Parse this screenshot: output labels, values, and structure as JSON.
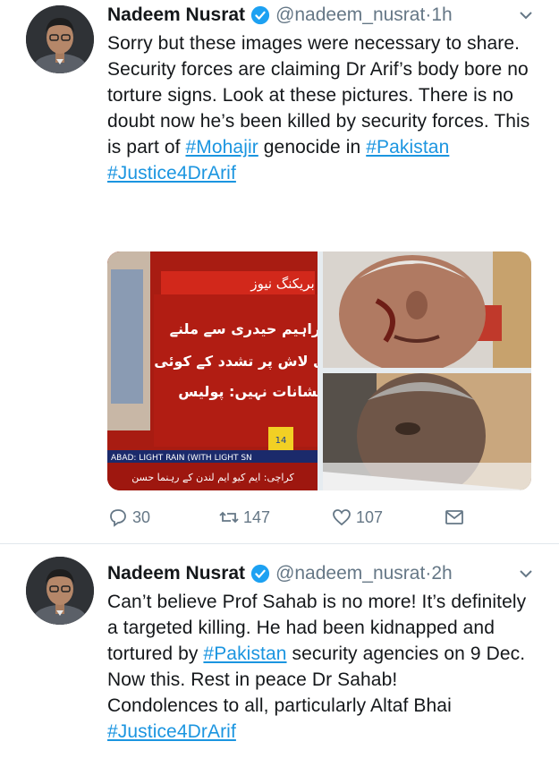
{
  "tweets": [
    {
      "author_name": "Nadeem Nusrat",
      "handle": "@nadeem_nusrat",
      "time": "1h",
      "body_lines": [
        "Sorry but these images were necessary to share.",
        "Security forces are claiming Dr Arif’s body bore no torture signs. Look at these pictures. There is no doubt now he’s been killed by security forces. This is part of"
      ],
      "hashtag_mohajir": "#Mohajir",
      "genocide_in": " genocide in ",
      "hashtag_pakistan": "#Pakistan",
      "hashtag_justice": "#Justice4DrArif",
      "media": {
        "news_header": "بریکنگ نیوز",
        "news_text_1": "ابراہیم حیدری سے ملنے",
        "news_text_2": "والی لاش پر تشدد کے کوئی",
        "news_text_3": "نشانات نہیں: پولیس",
        "ticker_top": "ABAD: LIGHT RAIN (WITH LIGHT SN",
        "ticker_bottom": "کراچی: ایم کیو ایم لندن کے رہنما حسن",
        "channel_badge": "14"
      },
      "replies": "30",
      "retweets": "147",
      "likes": "107"
    },
    {
      "author_name": "Nadeem Nusrat",
      "handle": "@nadeem_nusrat",
      "time": "2h",
      "body_part1": "Can’t believe Prof Sahab is no more! It’s definitely a targeted killing. He had been kidnapped and tortured by ",
      "hashtag_pakistan": "#Pakistan",
      "body_part2": " security agencies on 9 Dec. Now this. Rest in peace Dr Sahab!",
      "body_part3": "Condolences to all, particularly Altaf Bhai",
      "hashtag_justice": "#Justice4DrArif"
    }
  ],
  "colors": {
    "link": "#1b95e0",
    "muted": "#657786",
    "verified": "#1da1f2"
  }
}
